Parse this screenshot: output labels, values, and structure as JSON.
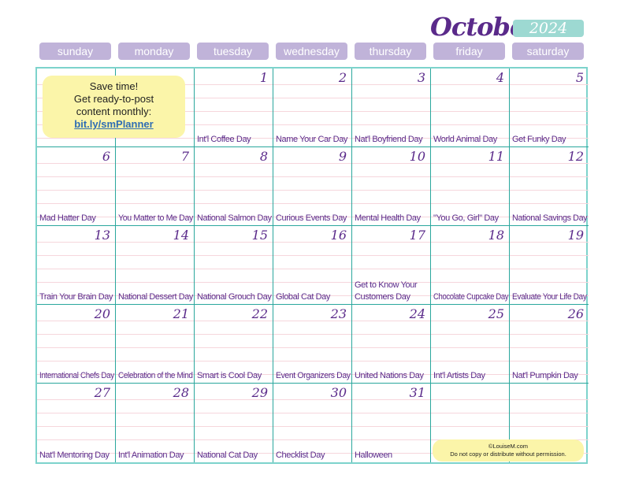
{
  "header": {
    "month": "October",
    "year": "2024"
  },
  "weekdays": [
    "sunday",
    "monday",
    "tuesday",
    "wednesday",
    "thursday",
    "friday",
    "saturday"
  ],
  "promo": {
    "line1": "Save time!",
    "line2": "Get ready-to-post",
    "line3": "content monthly:",
    "link": "bit.ly/smPlanner"
  },
  "copyright": {
    "line1": "©LouiseM.com",
    "line2": "Do not copy or distribute without permission."
  },
  "days": [
    {
      "day": "1",
      "event": "Int'l Coffee Day"
    },
    {
      "day": "2",
      "event": "Name Your Car Day"
    },
    {
      "day": "3",
      "event": "Nat'l Boyfriend Day"
    },
    {
      "day": "4",
      "event": "World Animal Day"
    },
    {
      "day": "5",
      "event": "Get Funky Day"
    },
    {
      "day": "6",
      "event": "Mad Hatter Day"
    },
    {
      "day": "7",
      "event": "You Matter to Me Day"
    },
    {
      "day": "8",
      "event": "National Salmon Day"
    },
    {
      "day": "9",
      "event": "Curious Events Day"
    },
    {
      "day": "10",
      "event": "Mental Health Day"
    },
    {
      "day": "11",
      "event": "\"You Go, Girl\" Day"
    },
    {
      "day": "12",
      "event": "National Savings Day"
    },
    {
      "day": "13",
      "event": "Train Your Brain Day"
    },
    {
      "day": "14",
      "event": "National Dessert Day"
    },
    {
      "day": "15",
      "event": "National Grouch Day"
    },
    {
      "day": "16",
      "event": "Global Cat Day"
    },
    {
      "day": "17",
      "event": "Get to Know Your Customers Day"
    },
    {
      "day": "18",
      "event": "Chocolate Cupcake Day"
    },
    {
      "day": "19",
      "event": "Evaluate Your Life Day"
    },
    {
      "day": "20",
      "event": "International Chefs Day"
    },
    {
      "day": "21",
      "event": "Celebration of the Mind"
    },
    {
      "day": "22",
      "event": "Smart is Cool Day"
    },
    {
      "day": "23",
      "event": "Event Organizers Day"
    },
    {
      "day": "24",
      "event": "United Nations Day"
    },
    {
      "day": "25",
      "event": "Int'l Artists Day"
    },
    {
      "day": "26",
      "event": "Nat'l Pumpkin Day"
    },
    {
      "day": "27",
      "event": "Nat'l Mentoring Day"
    },
    {
      "day": "28",
      "event": "Int'l Animation Day"
    },
    {
      "day": "29",
      "event": "National Cat Day"
    },
    {
      "day": "30",
      "event": "Checklist Day"
    },
    {
      "day": "31",
      "event": "Halloween"
    }
  ],
  "colors": {
    "accent_purple": "#5a2a8a",
    "header_lavender": "#c0b3d9",
    "year_teal": "#9dd9d2",
    "grid_teal": "#2aa79d",
    "note_yellow": "#fbf5a9"
  }
}
